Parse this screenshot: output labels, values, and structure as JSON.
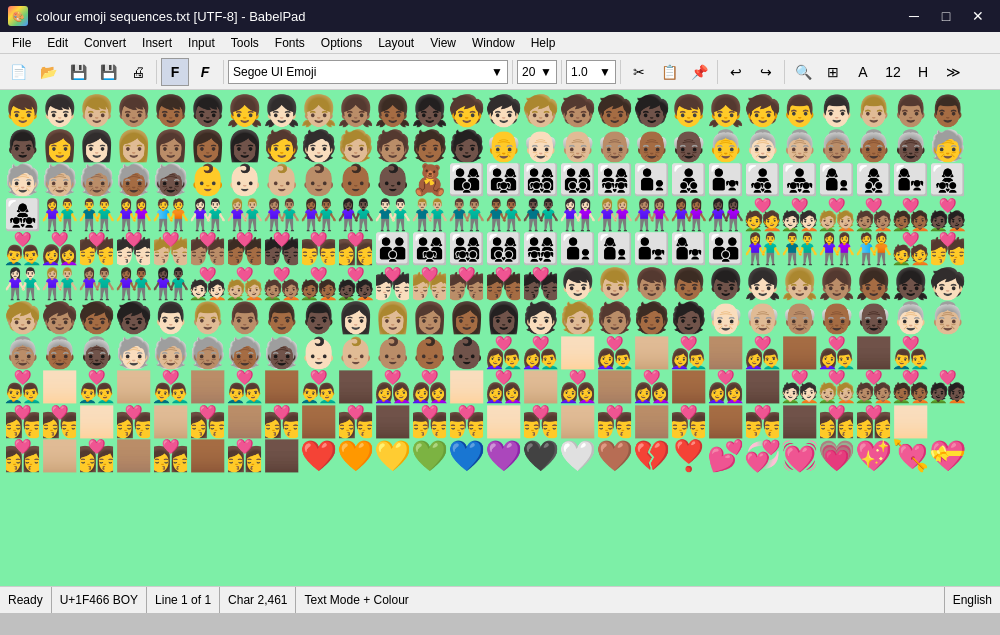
{
  "titlebar": {
    "title": "colour emoji sequences.txt [UTF-8] - BabelPad",
    "icon": "🎨",
    "minimize": "─",
    "maximize": "□",
    "close": "✕"
  },
  "menubar": {
    "items": [
      "File",
      "Edit",
      "Convert",
      "Insert",
      "Input",
      "Tools",
      "Fonts",
      "Options",
      "Layout",
      "View",
      "Window",
      "Help"
    ]
  },
  "toolbar": {
    "font_bold_label": "F",
    "font_italic_label": "F",
    "font_name": "Segoe UI Emoji",
    "font_size": "20",
    "line_spacing": "1.0"
  },
  "content": {
    "emojis": "👦👦🏻👦🏼👦🏽👦🏾👦🏿👧👧🏻👧🏼👧🏽👧🏾👧🏿🧒🧒🏻🧒🏼🧒🏽🧒🏾🧒🏿👦👧🧒👨👨🏻👨🏼👨🏽👨🏾👨🏿👩👩🏻👩🏼👩🏽👩🏾👩🏿🧑🧑🏻🧑🏼🧑🏽🧑🏾🧑🏿👴👴🏻👴🏼👴🏽👴🏾👴🏿👵👵🏻👵🏼👵🏽👵🏾👵🏿🧓🧓🏻🧓🏼🧓🏽🧓🏾🧓🏿👶👶🏻👶🏼👶🏽👶🏾👶🏿🧸👨‍👩‍👦👨‍👩‍👧👨‍👩‍👧‍👦👨‍👩‍👦‍👦👨‍👩‍👧‍👧👨‍👦👨‍👦‍👦👨‍👧👨‍👧‍👦👨‍👧‍👧👩‍👦👩‍👦‍👦👩‍👧👩‍👧‍👦👩‍👧‍👧👫👬👭🧑‍🤝‍🧑👫🏻👫🏼👫🏽👫🏾👫🏿👬🏻👬🏼👬🏽👬🏾👬🏿👭🏻👭🏼👭🏽👭🏾👭🏿💑💑🏻💑🏼💑🏽💑🏾💑🏿👨‍❤️‍👨👩‍❤️‍👩💏💏🏻💏🏼💏🏽💏🏾💏🏿👨‍❤️‍💋‍👨👩‍❤️‍💋‍👩❤️🧡💛💚💙💜🖤🤍🤎💔❣️💕💞💓💗💖💘💝"
  },
  "statusbar": {
    "ready": "Ready",
    "position": "U+1F466 BOY",
    "line": "Line 1 of 1",
    "chars": "Char 2,461",
    "mode": "Text Mode + Colour",
    "language": "English"
  }
}
